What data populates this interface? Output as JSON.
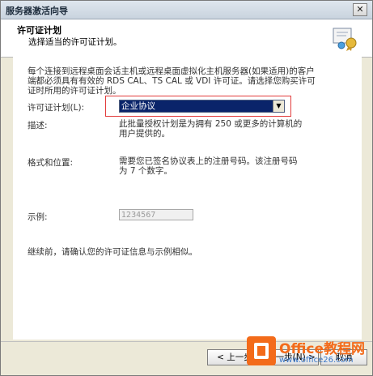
{
  "window": {
    "title": "服务器激活向导",
    "close_glyph": "✕"
  },
  "header": {
    "title": "许可证计划",
    "subtitle": "选择适当的许可证计划。"
  },
  "intro": "每个连接到远程桌面会话主机或远程桌面虚拟化主机服务器(如果适用)的客户端都必须具有有效的 RDS CAL、TS CAL 或 VDI 许可证。请选择您购买许可证时所用的许可证计划。",
  "license_plan": {
    "label": "许可证计划(L):",
    "selected": "企业协议",
    "arrow": "▼"
  },
  "description": {
    "label": "描述:",
    "text": "此批量授权计划是为拥有 250 或更多的计算机的用户提供的。"
  },
  "format": {
    "label": "格式和位置:",
    "text": "需要您已签名协议表上的注册号码。该注册号码为 7 个数字。"
  },
  "example": {
    "label": "示例:",
    "value": "1234567"
  },
  "confirm_note": "继续前，请确认您的许可证信息与示例相似。",
  "buttons": {
    "back": "< 上一步",
    "next": "下一步(N) >",
    "cancel": "取消"
  },
  "watermark": {
    "brand": "Office教程网",
    "url": "www.office26.com"
  }
}
